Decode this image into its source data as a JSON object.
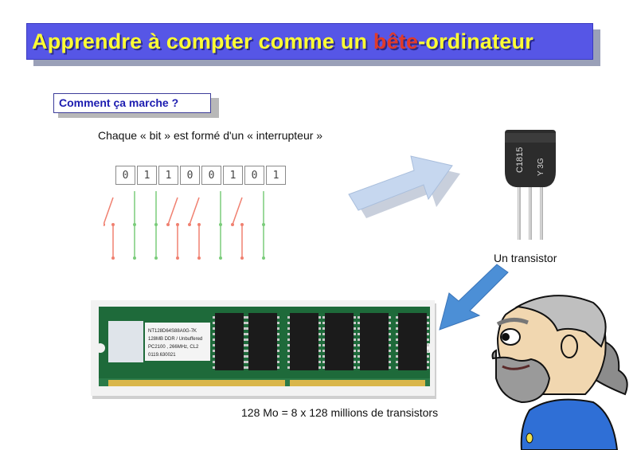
{
  "title": {
    "part1": "Apprendre à compter comme un ",
    "highlight": "bête",
    "part2": "-ordinateur"
  },
  "section_label": "Comment ça marche ?",
  "bit_caption": "Chaque « bit » est formé d'un « interrupteur »",
  "bits": [
    "0",
    "1",
    "1",
    "0",
    "0",
    "1",
    "0",
    "1"
  ],
  "transistor_caption": "Un transistor",
  "transistor_marking": {
    "line1": "C1815",
    "line2": "Y 3G"
  },
  "ram_caption": "128 Mo = 8 x 128 millions de transistors",
  "ram_label": {
    "line1": "NT128D64S88A0G-7K",
    "line2": "128MB DDR / Unbuffered",
    "line3": "PC2100 , 266MHz, CL2",
    "line4": "0119.630021"
  },
  "colors": {
    "banner": "#5656e6",
    "title_text": "#ffff33",
    "title_highlight": "#e03a2a",
    "switch_on": "#7acc7a",
    "switch_off": "#f08070",
    "arrow": "#bcd0ea"
  }
}
